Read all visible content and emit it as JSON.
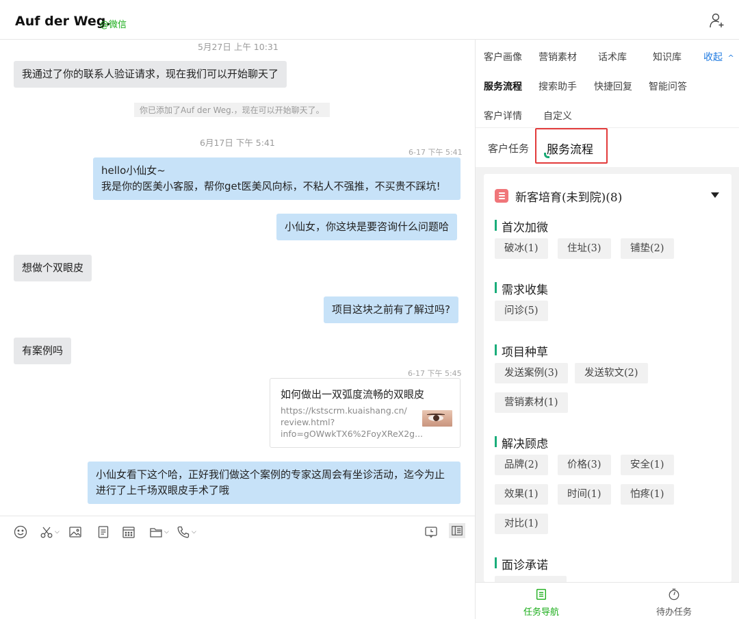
{
  "header": {
    "contact_name": "Auf der Weg.",
    "source_tag": "@微信"
  },
  "chat": {
    "timestamps": [
      "5月27日 上午 10:31",
      "6月17日 下午 5:41"
    ],
    "message_times": [
      "6-17 下午 5:41",
      "6-17 下午 5:45"
    ],
    "messages": [
      {
        "dir": "in",
        "text": "我通过了你的联系人验证请求，现在我们可以开始聊天了"
      },
      {
        "dir": "sys",
        "text": "你已添加了Auf der Weg.，现在可以开始聊天了。"
      },
      {
        "dir": "out",
        "line1": "hello小仙女~",
        "line2": "我是你的医美小客服，帮你get医美风向标，不粘人不强推，不买贵不踩坑!"
      },
      {
        "dir": "out",
        "text": "小仙女，你这块是要咨询什么问题哈"
      },
      {
        "dir": "in",
        "text": "想做个双眼皮"
      },
      {
        "dir": "out",
        "text": "项目这块之前有了解过吗?"
      },
      {
        "dir": "in",
        "text": "有案例吗"
      },
      {
        "dir": "out",
        "line1": "小仙女看下这个哈，正好我们做这个案例的专家这周会有坐诊活动，迄今为止",
        "line2": "进行了上千场双眼皮手术了哦"
      }
    ],
    "link_card": {
      "title": "如何做出一双弧度流畅的双眼皮",
      "desc_line1": "https://kstscrm.kuaishang.cn/",
      "desc_line2": "review.html?",
      "desc_line3": "info=gOWwkTX6%2FoyXReX2g..."
    }
  },
  "toolbar": {
    "icons": [
      "emoji-icon",
      "scissors-icon",
      "image-icon",
      "document-icon",
      "calendar-icon",
      "folder-icon",
      "phone-icon",
      "chat-history-icon",
      "sidebar-toggle-icon"
    ]
  },
  "panel": {
    "tabs_row1": [
      "客户画像",
      "营销素材",
      "话术库",
      "知识库"
    ],
    "collapse_label": "收起",
    "collapse_glyph": "^",
    "tabs_row2": [
      "服务流程",
      "搜索助手",
      "快捷回复",
      "智能问答"
    ],
    "tabs_row3": [
      "客户详情",
      "自定义"
    ],
    "subtabs": [
      "客户任务",
      "服务流程"
    ],
    "section_title": "新客培育(未到院)(8)",
    "groups": [
      {
        "name": "首次加微",
        "chips": [
          "破冰(1)",
          "住址(3)",
          "铺垫(2)"
        ]
      },
      {
        "name": "需求收集",
        "chips": [
          "问诊(5)"
        ]
      },
      {
        "name": "项目种草",
        "chips": [
          "发送案例(3)",
          "发送软文(2)",
          "营销素材(1)"
        ]
      },
      {
        "name": "解决顾虑",
        "chips": [
          "品牌(2)",
          "价格(3)",
          "安全(1)",
          "效果(1)",
          "时间(1)",
          "怕疼(1)",
          "对比(1)"
        ]
      },
      {
        "name": "面诊承诺",
        "chips": []
      }
    ],
    "bottom_nav": [
      "任务导航",
      "待办任务"
    ]
  },
  "colors": {
    "accent_green": "#1aad19",
    "link_blue": "#1f7ae0",
    "outgoing_bubble": "#c7e2f8",
    "incoming_bubble": "#e7e8ea",
    "highlight_red": "#e23a3a"
  }
}
